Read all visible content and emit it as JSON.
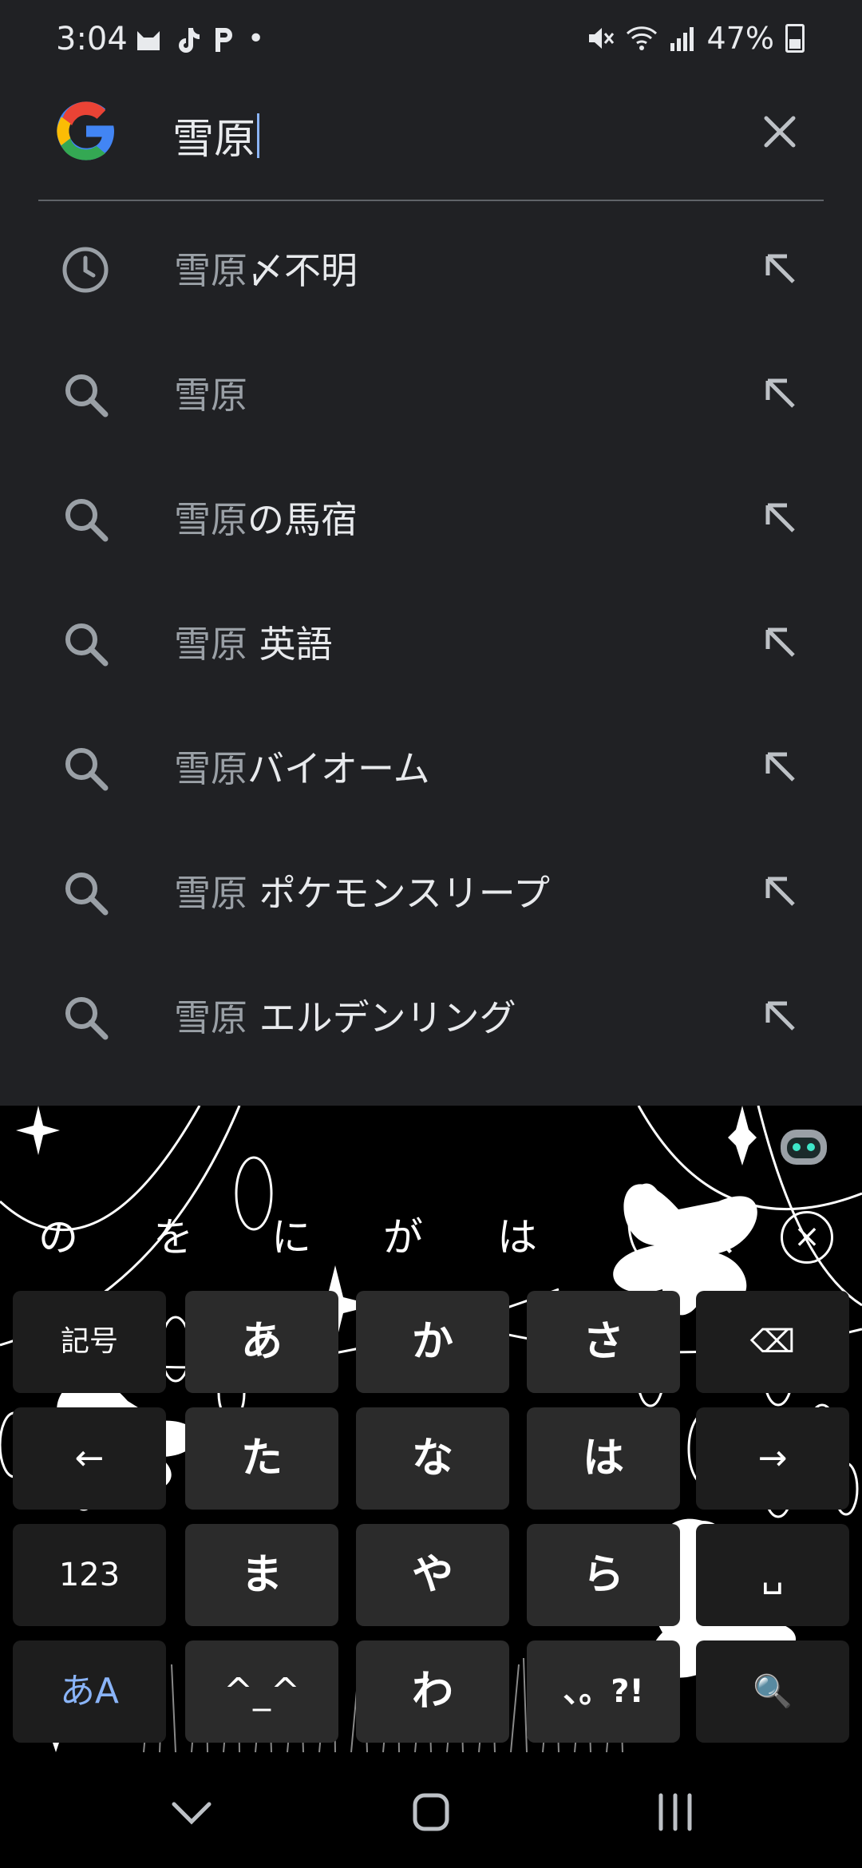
{
  "status": {
    "time": "3:04",
    "app_icons": [
      "cat-app-icon",
      "tiktok-icon",
      "p-app-icon"
    ],
    "dot": "•",
    "battery": "47%"
  },
  "search": {
    "query": "雪原"
  },
  "suggestions": [
    {
      "type": "history",
      "prefix": "雪原",
      "rest": "〆不明"
    },
    {
      "type": "search",
      "prefix": "雪原",
      "rest": ""
    },
    {
      "type": "search",
      "prefix": "雪原",
      "rest": "の馬宿"
    },
    {
      "type": "search",
      "prefix": "雪原",
      "rest": " 英語"
    },
    {
      "type": "search",
      "prefix": "雪原",
      "rest": "バイオーム"
    },
    {
      "type": "search",
      "prefix": "雪原",
      "rest": " ポケモンスリープ"
    },
    {
      "type": "search",
      "prefix": "雪原",
      "rest": " エルデンリング"
    }
  ],
  "keyboard": {
    "candidates": [
      "の",
      "を",
      "に",
      "が",
      "は",
      "、"
    ],
    "rows": [
      [
        "記号",
        "あ",
        "か",
        "さ",
        "⌫"
      ],
      [
        "←",
        "た",
        "な",
        "は",
        "→"
      ],
      [
        "123",
        "ま",
        "や",
        "ら",
        "␣"
      ],
      [
        "あA",
        "^_^",
        "わ",
        "、。?!",
        "🔍"
      ]
    ]
  }
}
